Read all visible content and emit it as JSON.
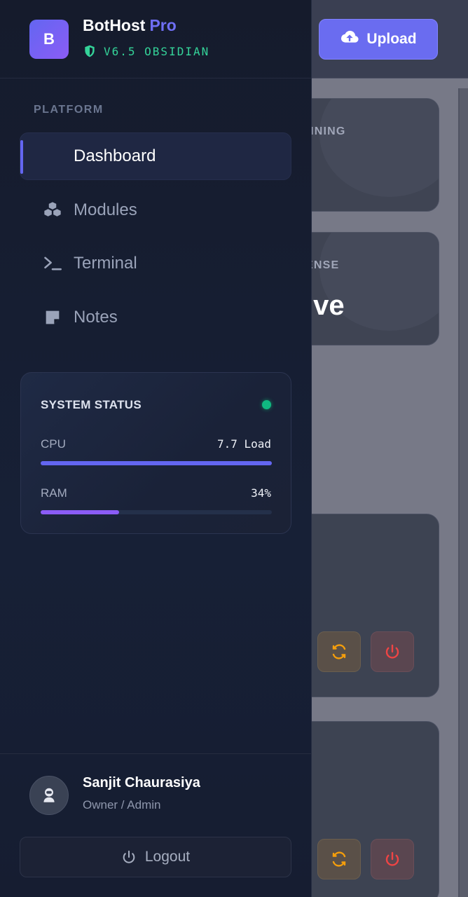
{
  "brand": {
    "logo_letter": "B",
    "name": "BotHost",
    "name_suffix": "Pro",
    "version": "V6.5 OBSIDIAN",
    "icon": "shield-icon"
  },
  "header": {
    "upload_label": "Upload",
    "upload_icon": "cloud-upload-icon"
  },
  "sidebar": {
    "section_title": "PLATFORM",
    "items": [
      {
        "label": "Dashboard",
        "icon": "grid-icon",
        "active": true
      },
      {
        "label": "Modules",
        "icon": "cubes-icon",
        "active": false
      },
      {
        "label": "Terminal",
        "icon": "terminal-icon",
        "active": false
      },
      {
        "label": "Notes",
        "icon": "sticky-note-icon",
        "active": false
      }
    ]
  },
  "system_status": {
    "title": "SYSTEM STATUS",
    "indicator_color": "#10b981",
    "cpu": {
      "label": "CPU",
      "value": "7.7 Load",
      "fraction": 1.0,
      "color": "#6366f1"
    },
    "ram": {
      "label": "RAM",
      "value": "34%",
      "fraction": 0.34,
      "color": "#8b5cf6"
    }
  },
  "user": {
    "name": "Sanjit Chaurasiya",
    "role": "Owner / Admin",
    "avatar_icon": "user-astronaut-icon"
  },
  "logout": {
    "label": "Logout",
    "icon": "power-icon"
  },
  "background": {
    "card1_label": "NNING",
    "card2_label": "ENSE",
    "card2_value": "ive"
  },
  "colors": {
    "accent": "#6366f1",
    "accent_secondary": "#8b5cf6",
    "success": "#34d399",
    "warning": "#f59e0b",
    "danger": "#ef4444"
  }
}
